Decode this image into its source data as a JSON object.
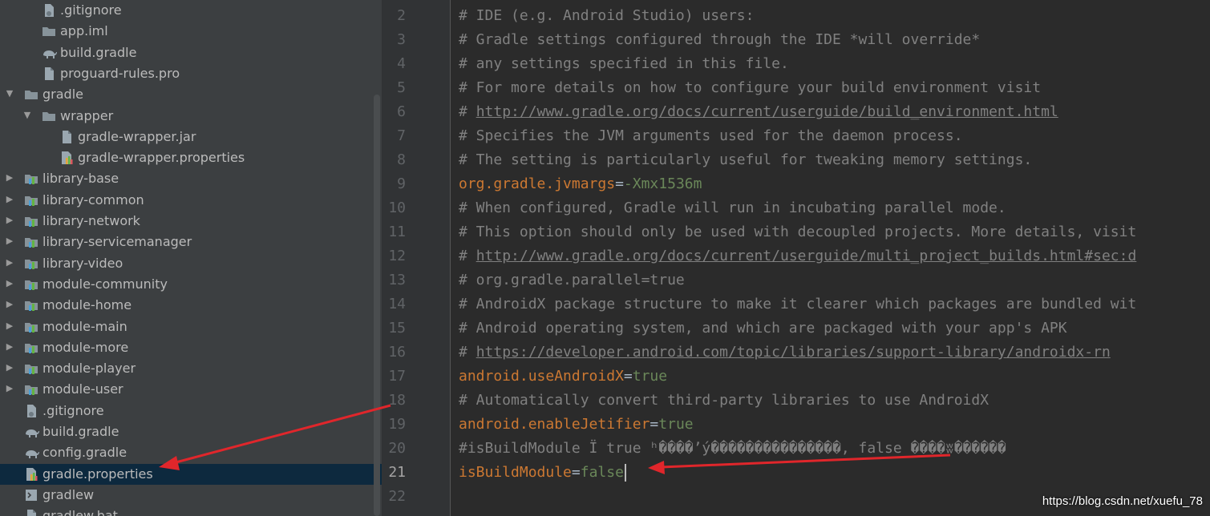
{
  "project_tree": {
    "items": [
      {
        "label": ".gitignore",
        "icon": "git-file-icon",
        "indent": 2,
        "arrow": ""
      },
      {
        "label": "app.iml",
        "icon": "folder-icon",
        "indent": 2,
        "arrow": ""
      },
      {
        "label": "build.gradle",
        "icon": "gradle-elephant-icon",
        "indent": 2,
        "arrow": ""
      },
      {
        "label": "proguard-rules.pro",
        "icon": "file-icon",
        "indent": 2,
        "arrow": ""
      },
      {
        "label": "gradle",
        "icon": "folder-icon",
        "indent": 1,
        "arrow": "expanded"
      },
      {
        "label": "wrapper",
        "icon": "folder-icon",
        "indent": 2,
        "arrow": "expanded"
      },
      {
        "label": "gradle-wrapper.jar",
        "icon": "file-icon",
        "indent": 3,
        "arrow": ""
      },
      {
        "label": "gradle-wrapper.properties",
        "icon": "properties-file-icon",
        "indent": 3,
        "arrow": ""
      },
      {
        "label": "library-base",
        "icon": "module-folder-icon",
        "indent": 1,
        "arrow": "collapsed"
      },
      {
        "label": "library-common",
        "icon": "module-folder-icon",
        "indent": 1,
        "arrow": "collapsed"
      },
      {
        "label": "library-network",
        "icon": "module-folder-icon",
        "indent": 1,
        "arrow": "collapsed"
      },
      {
        "label": "library-servicemanager",
        "icon": "module-folder-icon",
        "indent": 1,
        "arrow": "collapsed"
      },
      {
        "label": "library-video",
        "icon": "module-folder-icon",
        "indent": 1,
        "arrow": "collapsed"
      },
      {
        "label": "module-community",
        "icon": "module-folder-icon",
        "indent": 1,
        "arrow": "collapsed"
      },
      {
        "label": "module-home",
        "icon": "module-folder-icon",
        "indent": 1,
        "arrow": "collapsed"
      },
      {
        "label": "module-main",
        "icon": "module-folder-icon",
        "indent": 1,
        "arrow": "collapsed"
      },
      {
        "label": "module-more",
        "icon": "module-folder-icon",
        "indent": 1,
        "arrow": "collapsed"
      },
      {
        "label": "module-player",
        "icon": "module-folder-icon",
        "indent": 1,
        "arrow": "collapsed"
      },
      {
        "label": "module-user",
        "icon": "module-folder-icon",
        "indent": 1,
        "arrow": "collapsed"
      },
      {
        "label": ".gitignore",
        "icon": "git-file-icon",
        "indent": 1,
        "arrow": ""
      },
      {
        "label": "build.gradle",
        "icon": "gradle-elephant-icon",
        "indent": 1,
        "arrow": ""
      },
      {
        "label": "config.gradle",
        "icon": "gradle-elephant-icon",
        "indent": 1,
        "arrow": ""
      },
      {
        "label": "gradle.properties",
        "icon": "properties-file-icon",
        "indent": 1,
        "arrow": "",
        "selected": true
      },
      {
        "label": "gradlew",
        "icon": "terminal-file-icon",
        "indent": 1,
        "arrow": ""
      },
      {
        "label": "gradlew.bat",
        "icon": "file-icon",
        "indent": 1,
        "arrow": ""
      }
    ]
  },
  "editor": {
    "current_line": 21,
    "lines": [
      {
        "num": "2",
        "parts": [
          {
            "t": "# IDE (e.g. Android Studio) users:",
            "c": "cm"
          }
        ]
      },
      {
        "num": "3",
        "parts": [
          {
            "t": "# Gradle settings configured through the IDE *will override*",
            "c": "cm"
          }
        ]
      },
      {
        "num": "4",
        "parts": [
          {
            "t": "# any settings specified in this file.",
            "c": "cm"
          }
        ]
      },
      {
        "num": "5",
        "parts": [
          {
            "t": "# For more details on how to configure your build environment visit",
            "c": "cm"
          }
        ]
      },
      {
        "num": "6",
        "parts": [
          {
            "t": "# ",
            "c": "cm"
          },
          {
            "t": "http://www.gradle.org/docs/current/userguide/build_environment.html",
            "c": "url"
          }
        ]
      },
      {
        "num": "7",
        "parts": [
          {
            "t": "# Specifies the JVM arguments used for the daemon process.",
            "c": "cm"
          }
        ]
      },
      {
        "num": "8",
        "parts": [
          {
            "t": "# The setting is particularly useful for tweaking memory settings.",
            "c": "cm"
          }
        ]
      },
      {
        "num": "9",
        "parts": [
          {
            "t": "org.gradle.jvmargs",
            "c": "key"
          },
          {
            "t": "=",
            "c": "eq"
          },
          {
            "t": "-Xmx1536m",
            "c": "val"
          }
        ]
      },
      {
        "num": "10",
        "parts": [
          {
            "t": "# When configured, Gradle will run in incubating parallel mode.",
            "c": "cm"
          }
        ]
      },
      {
        "num": "11",
        "parts": [
          {
            "t": "# This option should only be used with decoupled projects. More details, visit",
            "c": "cm"
          }
        ]
      },
      {
        "num": "12",
        "parts": [
          {
            "t": "# ",
            "c": "cm"
          },
          {
            "t": "http://www.gradle.org/docs/current/userguide/multi_project_builds.html#sec:d",
            "c": "url"
          }
        ]
      },
      {
        "num": "13",
        "parts": [
          {
            "t": "# org.gradle.parallel=true",
            "c": "cm"
          }
        ]
      },
      {
        "num": "14",
        "parts": [
          {
            "t": "# AndroidX package structure to make it clearer which packages are bundled wit",
            "c": "cm"
          }
        ]
      },
      {
        "num": "15",
        "parts": [
          {
            "t": "# Android operating system, and which are packaged with your app's APK",
            "c": "cm"
          }
        ]
      },
      {
        "num": "16",
        "parts": [
          {
            "t": "# ",
            "c": "cm"
          },
          {
            "t": "https://developer.android.com/topic/libraries/support-library/androidx-rn",
            "c": "url"
          }
        ]
      },
      {
        "num": "17",
        "parts": [
          {
            "t": "android.useAndroidX",
            "c": "key"
          },
          {
            "t": "=",
            "c": "eq"
          },
          {
            "t": "true",
            "c": "val"
          }
        ]
      },
      {
        "num": "18",
        "parts": [
          {
            "t": "# Automatically convert third-party libraries to use AndroidX",
            "c": "cm"
          }
        ]
      },
      {
        "num": "19",
        "parts": [
          {
            "t": "android.enableJetifier",
            "c": "key"
          },
          {
            "t": "=",
            "c": "eq"
          },
          {
            "t": "true",
            "c": "val"
          }
        ]
      },
      {
        "num": "20",
        "parts": [
          {
            "t": "#isBuildModule Ï true ʰ����ʼý���������������, false ����ʬ������",
            "c": "cm"
          }
        ]
      },
      {
        "num": "21",
        "parts": [
          {
            "t": "isBuildModule",
            "c": "key"
          },
          {
            "t": "=",
            "c": "eq"
          },
          {
            "t": "false",
            "c": "val"
          }
        ]
      },
      {
        "num": "22",
        "parts": []
      }
    ]
  },
  "watermark": "https://blog.csdn.net/xuefu_78",
  "colors": {
    "annotation_arrow": "#e0262b",
    "selection": "#0d293e",
    "comment": "#808080",
    "keyword": "#cc7832",
    "value": "#6a8759"
  }
}
